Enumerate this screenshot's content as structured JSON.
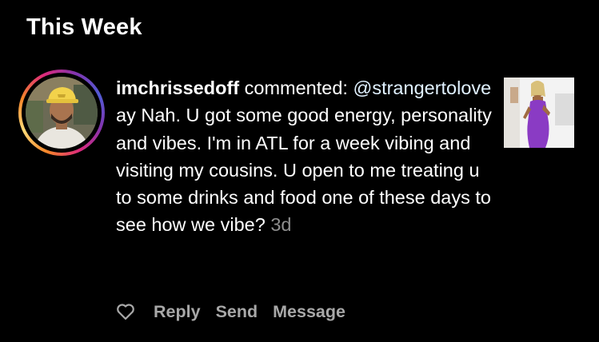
{
  "section": {
    "title": "This Week"
  },
  "notification": {
    "username": "imchrissedoff",
    "action": "commented:",
    "mention": "@strangertolove",
    "comment_text": "ay Nah. U got some good energy, personality and vibes. I'm in ATL for a week vibing and visiting my cousins. U open to me treating u to some drinks and food one of these days to see how we vibe?",
    "timestamp": "3d",
    "avatar_icon": "profile-photo",
    "thumbnail_icon": "post-thumbnail"
  },
  "actions": {
    "like_icon": "heart-icon",
    "reply_label": "Reply",
    "send_label": "Send",
    "message_label": "Message"
  },
  "colors": {
    "background": "#000000",
    "text": "#ffffff",
    "secondary_text": "#8e8e8e",
    "action_text": "#a8a8a8",
    "story_ring_start": "#f58529",
    "story_ring_end": "#8134af"
  }
}
